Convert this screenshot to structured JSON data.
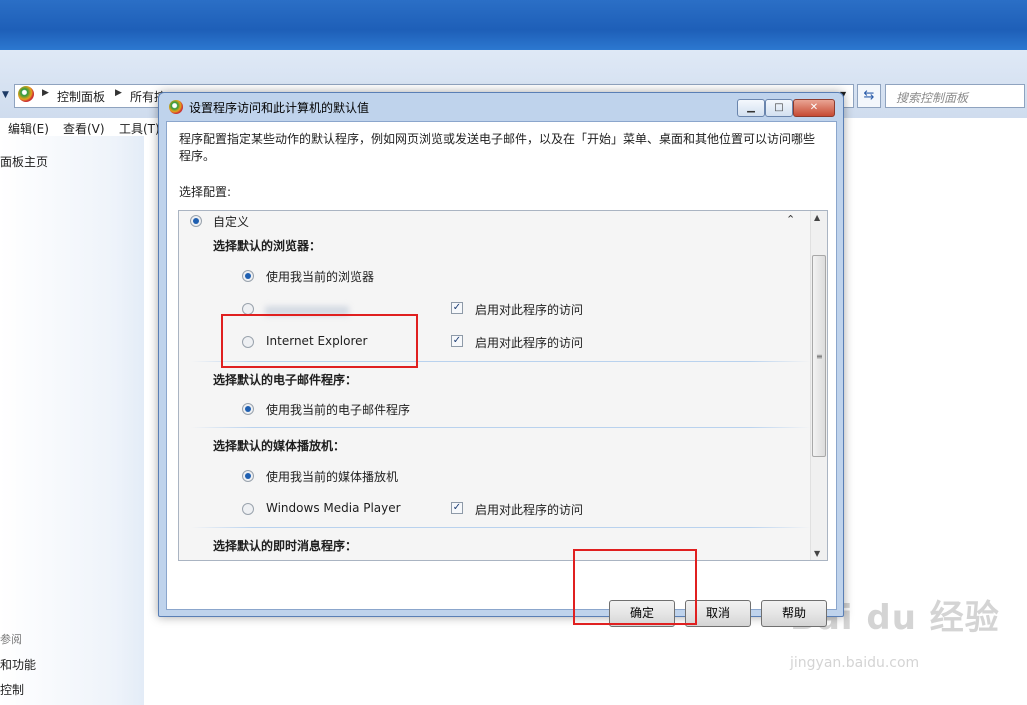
{
  "background": {
    "breadcrumb": [
      "控制面板",
      "所有控"
    ],
    "search_placeholder": "搜索控制面板",
    "menu": [
      "编辑(E)",
      "查看(V)",
      "工具(T)"
    ],
    "left_links": {
      "home": "面板主页",
      "see_also": "参阅",
      "link1": "和功能",
      "link2": "控制"
    }
  },
  "dialog": {
    "title": "设置程序访问和此计算机的默认值",
    "description": "程序配置指定某些动作的默认程序，例如网页浏览或发送电子邮件，以及在「开始」菜单、桌面和其他位置可以访问哪些程序。",
    "select_config_label": "选择配置:",
    "config_name": "自定义",
    "sections": [
      {
        "heading": "选择默认的浏览器：",
        "options": [
          {
            "label": "使用我当前的浏览器",
            "selected": true
          },
          {
            "label": "",
            "selected": false,
            "enable_access": true
          },
          {
            "label": "Internet Explorer",
            "selected": false,
            "enable_access": true
          }
        ]
      },
      {
        "heading": "选择默认的电子邮件程序：",
        "options": [
          {
            "label": "使用我当前的电子邮件程序",
            "selected": true
          }
        ]
      },
      {
        "heading": "选择默认的媒体播放机：",
        "options": [
          {
            "label": "使用我当前的媒体播放机",
            "selected": true
          },
          {
            "label": "Windows Media Player",
            "selected": false,
            "enable_access": true
          }
        ]
      },
      {
        "heading": "选择默认的即时消息程序：",
        "options": []
      }
    ],
    "enable_access_label": "启用对此程序的访问",
    "buttons": {
      "ok": "确定",
      "cancel": "取消",
      "help": "帮助"
    }
  },
  "watermark": {
    "brand": "Bai du 经验",
    "url": "jingyan.baidu.com"
  },
  "colors": {
    "highlight_box": "#e02020",
    "title_bar": "#bfd3ec"
  }
}
